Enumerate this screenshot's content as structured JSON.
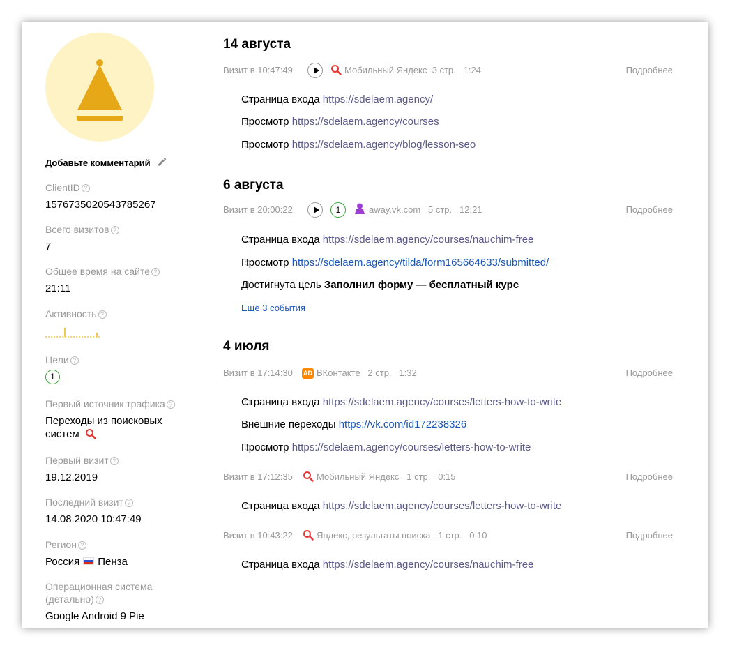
{
  "profile": {
    "comment_label": "Добавьте комментарий",
    "help_mark": "?",
    "fields": {
      "client_id": {
        "label": "ClientID",
        "value": "1576735020543785267"
      },
      "total_visits": {
        "label": "Всего визитов",
        "value": "7"
      },
      "total_time": {
        "label": "Общее время на сайте",
        "value": "21:11"
      },
      "activity": {
        "label": "Активность"
      },
      "goals": {
        "label": "Цели",
        "value": "1"
      },
      "first_source": {
        "label": "Первый источник трафика",
        "value_line1": "Переходы из поисковых",
        "value_line2": "систем"
      },
      "first_visit": {
        "label": "Первый визит",
        "value": "19.12.2019"
      },
      "last_visit": {
        "label": "Последний визит",
        "value": "14.08.2020 10:47:49"
      },
      "region": {
        "label": "Регион",
        "country": "Россия",
        "city": "Пенза"
      },
      "os": {
        "label_line1": "Операционная система",
        "label_line2": "(детально)",
        "value": "Google Android 9 Pie"
      }
    }
  },
  "more_label": "Подробнее",
  "days": [
    {
      "date": "14 августа",
      "visits": [
        {
          "time_label": "Визит в 10:47:49",
          "source": "Мобильный Яндекс",
          "pages": "3 стр.",
          "duration": "1:24",
          "events": [
            {
              "type": "Страница входа",
              "url": "https://sdelaem.agency/"
            },
            {
              "type": "Просмотр",
              "url": "https://sdelaem.agency/courses"
            },
            {
              "type": "Просмотр",
              "url": "https://sdelaem.agency/blog/lesson-seo"
            }
          ]
        }
      ]
    },
    {
      "date": "6 августа",
      "visits": [
        {
          "time_label": "Визит в 20:00:22",
          "goal_count": "1",
          "source": "away.vk.com",
          "pages": "5 стр.",
          "duration": "12:21",
          "events": [
            {
              "type": "Страница входа",
              "url": "https://sdelaem.agency/courses/nauchim-free"
            },
            {
              "type": "Просмотр",
              "url": "https://sdelaem.agency/tilda/form165664633/submitted/"
            },
            {
              "type": "Достигнута цель",
              "goal": "Заполнил форму — бесплатный курс"
            }
          ],
          "more_events": "Ещё 3 события"
        }
      ]
    },
    {
      "date": "4 июля",
      "visits": [
        {
          "time_label": "Визит в 17:14:30",
          "ad_badge": "AD",
          "source": "ВКонтакте",
          "pages": "2 стр.",
          "duration": "1:32",
          "events": [
            {
              "type": "Страница входа",
              "url": "https://sdelaem.agency/courses/letters-how-to-write"
            },
            {
              "type": "Внешние переходы",
              "url": "https://vk.com/id172238326"
            },
            {
              "type": "Просмотр",
              "url": "https://sdelaem.agency/courses/letters-how-to-write"
            }
          ]
        },
        {
          "time_label": "Визит в 17:12:35",
          "source": "Мобильный Яндекс",
          "pages": "1 стр.",
          "duration": "0:15",
          "events": [
            {
              "type": "Страница входа",
              "url": "https://sdelaem.agency/courses/letters-how-to-write"
            }
          ]
        },
        {
          "time_label": "Визит в 10:43:22",
          "source": "Яндекс, результаты поиска",
          "pages": "1 стр.",
          "duration": "0:10",
          "events": [
            {
              "type": "Страница входа",
              "url": "https://sdelaem.agency/courses/nauchim-free"
            }
          ]
        }
      ]
    }
  ],
  "colors": {
    "accent_link": "#1a56b8",
    "visited_link": "#5a5a8a",
    "goal": "#3aa33a",
    "avatar_bg": "#fdf3c4",
    "avatar_icon": "#e6a817"
  }
}
